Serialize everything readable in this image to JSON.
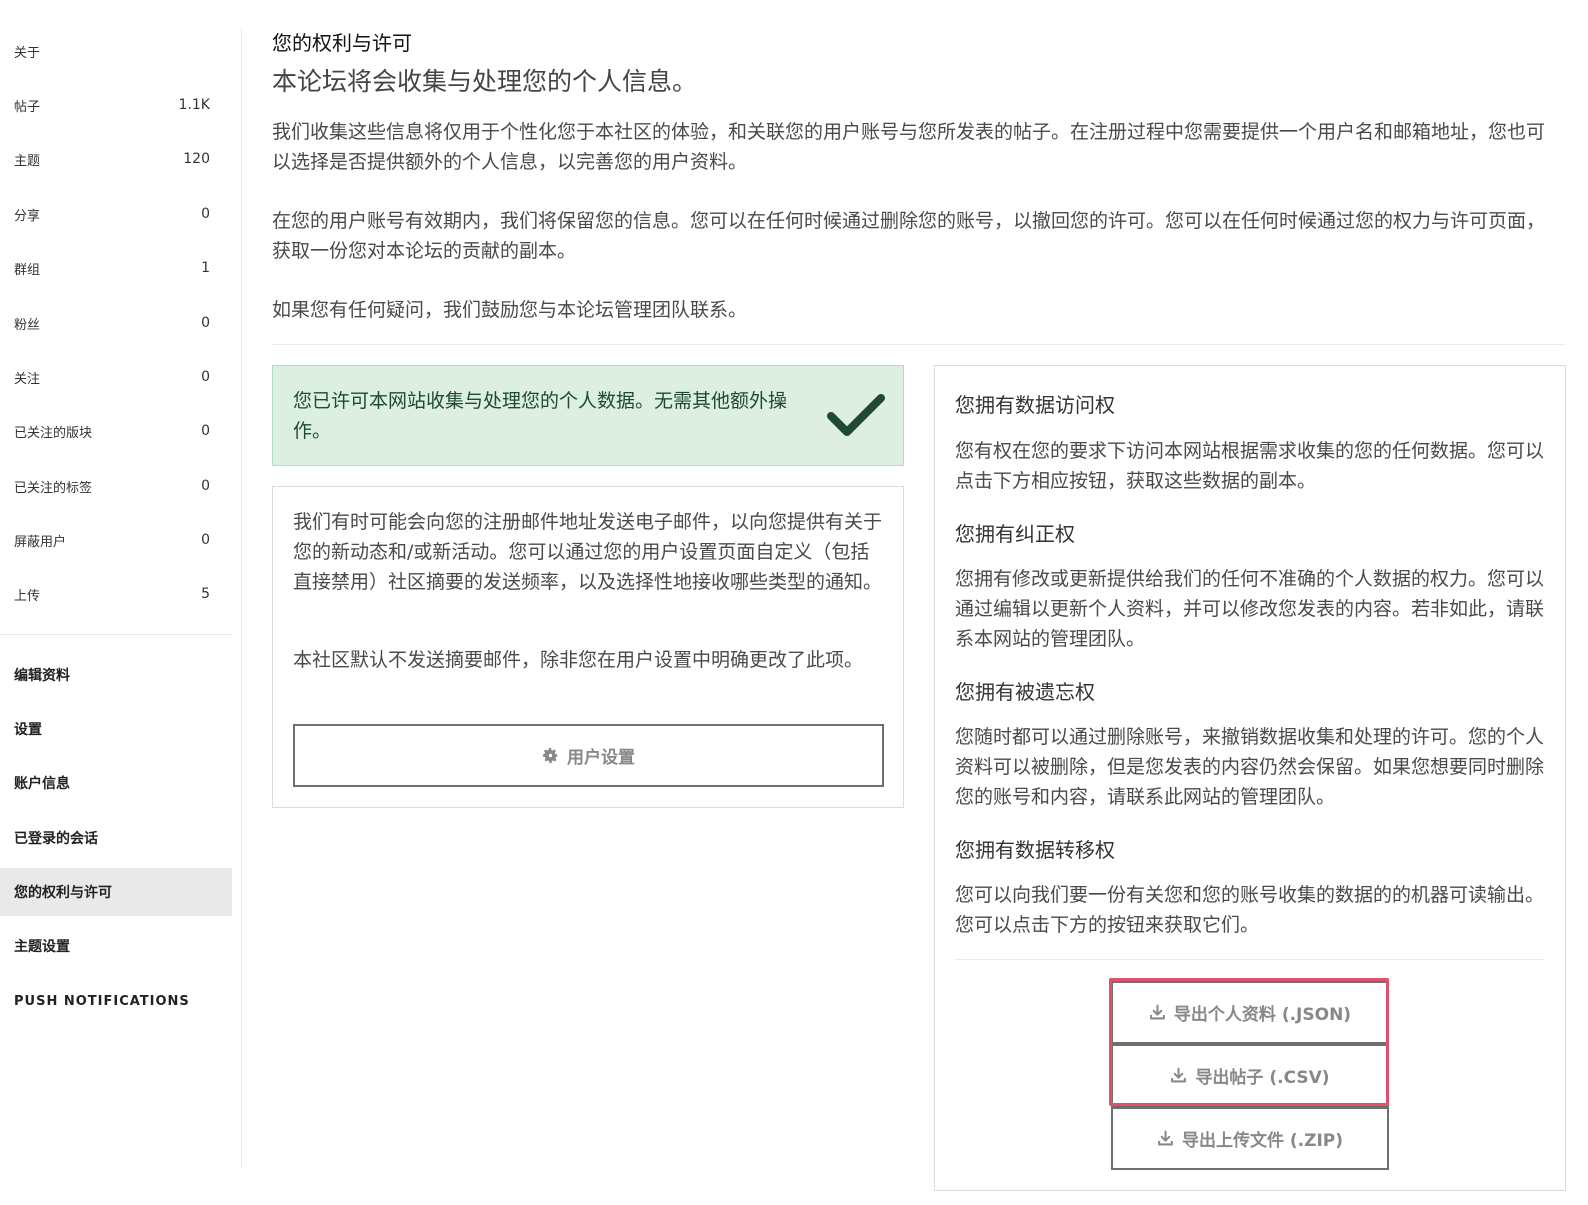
{
  "sidebar": {
    "stats": [
      {
        "label": "关于",
        "count": ""
      },
      {
        "label": "帖子",
        "count": "1.1K"
      },
      {
        "label": "主题",
        "count": "120"
      },
      {
        "label": "分享",
        "count": "0"
      },
      {
        "label": "群组",
        "count": "1"
      },
      {
        "label": "粉丝",
        "count": "0"
      },
      {
        "label": "关注",
        "count": "0"
      },
      {
        "label": "已关注的版块",
        "count": "0"
      },
      {
        "label": "已关注的标签",
        "count": "0"
      },
      {
        "label": "屏蔽用户",
        "count": "0"
      },
      {
        "label": "上传",
        "count": "5"
      }
    ],
    "nav": [
      {
        "label": "编辑资料"
      },
      {
        "label": "设置"
      },
      {
        "label": "账户信息"
      },
      {
        "label": "已登录的会话"
      },
      {
        "label": "您的权利与许可",
        "active": true
      },
      {
        "label": "主题设置"
      },
      {
        "label": "PUSH NOTIFICATIONS"
      }
    ]
  },
  "main": {
    "title": "您的权利与许可",
    "subtitle": "本论坛将会收集与处理您的个人信息。",
    "paragraphs": [
      "我们收集这些信息将仅用于个性化您于本社区的体验，和关联您的用户账号与您所发表的帖子。在注册过程中您需要提供一个用户名和邮箱地址，您也可以选择是否提供额外的个人信息，以完善您的用户资料。",
      "在您的用户账号有效期内，我们将保留您的信息。您可以在任何时候通过删除您的账号，以撤回您的许可。您可以在任何时候通过您的权力与许可页面，获取一份您对本论坛的贡献的副本。",
      "如果您有任何疑问，我们鼓励您与本论坛管理团队联系。"
    ],
    "consent": {
      "text": "您已许可本网站收集与处理您的个人数据。无需其他额外操作。",
      "icon": "checkmark-icon",
      "color": "#1f4a32"
    },
    "email": {
      "para1": "我们有时可能会向您的注册邮件地址发送电子邮件，以向您提供有关于您的新动态和/或新活动。您可以通过您的用户设置页面自定义（包括直接禁用）社区摘要的发送频率，以及选择性地接收哪些类型的通知。",
      "para2": "本社区默认不发送摘要邮件，除非您在用户设置中明确更改了此项。",
      "button_label": "用户设置",
      "button_icon": "gear-icon"
    },
    "rights": [
      {
        "heading": "您拥有数据访问权",
        "text": "您有权在您的要求下访问本网站根据需求收集的您的任何数据。您可以点击下方相应按钮，获取这些数据的副本。"
      },
      {
        "heading": "您拥有纠正权",
        "text": "您拥有修改或更新提供给我们的任何不准确的个人数据的权力。您可以通过编辑以更新个人资料，并可以修改您发表的内容。若非如此，请联系本网站的管理团队。"
      },
      {
        "heading": "您拥有被遗忘权",
        "text": "您随时都可以通过删除账号，来撤销数据收集和处理的许可。您的个人资料可以被删除，但是您发表的内容仍然会保留。如果您想要同时删除您的账号和内容，请联系此网站的管理团队。"
      },
      {
        "heading": "您拥有数据转移权",
        "text": "您可以向我们要一份有关您和您的账号收集的数据的的机器可读输出。您可以点击下方的按钮来获取它们。"
      }
    ],
    "exports": [
      {
        "label": "导出个人资料 (.JSON)",
        "icon": "download-icon"
      },
      {
        "label": "导出帖子 (.CSV)",
        "icon": "download-icon"
      },
      {
        "label": "导出上传文件 (.ZIP)",
        "icon": "download-icon"
      }
    ],
    "highlight_color": "#e0526c"
  }
}
